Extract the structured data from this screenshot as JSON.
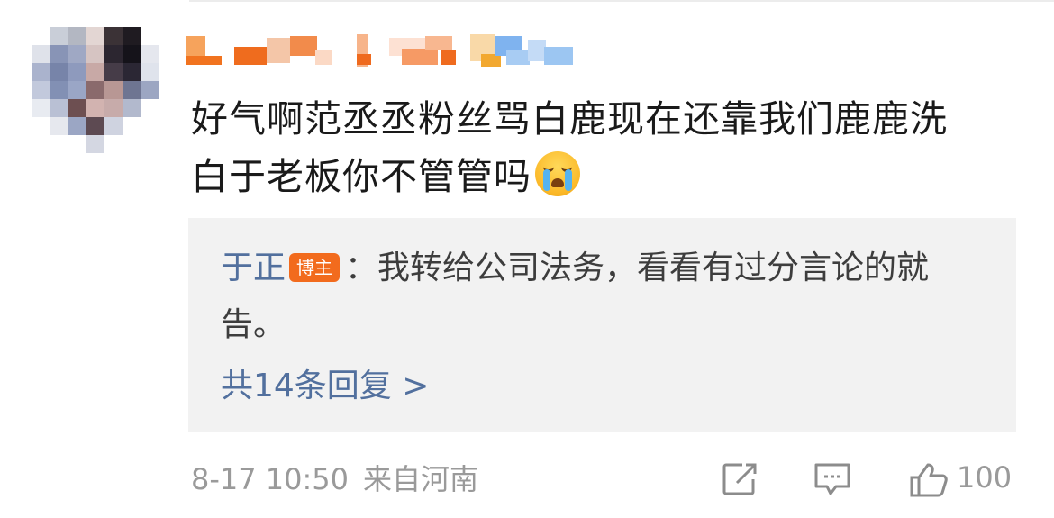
{
  "comment": {
    "line1": "好气啊范丞丞粉丝骂白鹿现在还靠我们鹿鹿洗",
    "line2": "白于老板你不管管吗",
    "emoji": "crying-face"
  },
  "reply": {
    "author": "于正",
    "badge": "博主",
    "separator": "：",
    "text": "我转给公司法务，看看有过分言论的就告。",
    "count_label": "共14条回复 >"
  },
  "footer": {
    "date": "8-17 10:50",
    "location": "来自河南",
    "like_count": "100"
  },
  "colors": {
    "link_blue": "#52709e",
    "badge_orange": "#f26b1d",
    "meta_gray": "#9a9a9a",
    "reply_bg": "#f2f2f2"
  },
  "icons": [
    "share-icon",
    "comment-icon",
    "like-icon"
  ]
}
